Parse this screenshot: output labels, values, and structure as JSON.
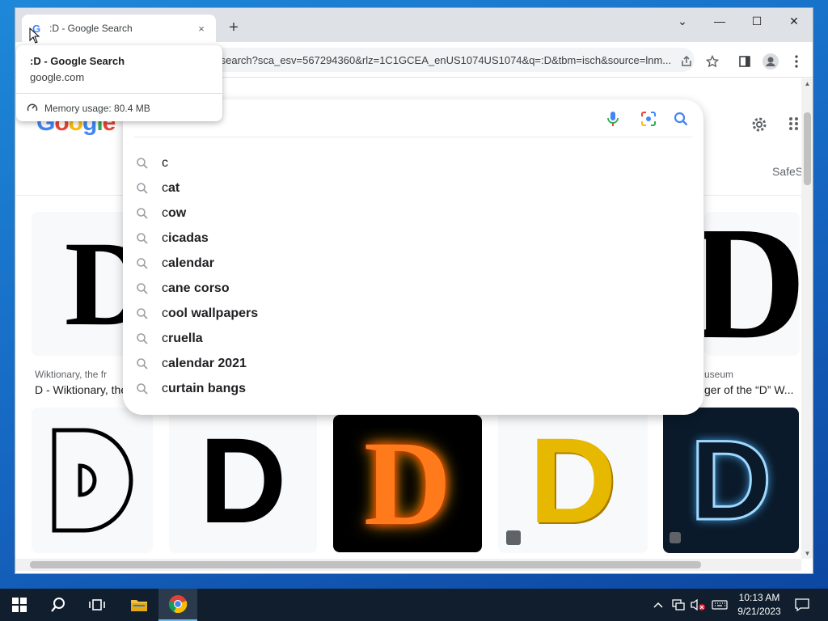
{
  "browser": {
    "tab": {
      "title": ":D - Google Search",
      "favicon": "G",
      "close": "×"
    },
    "new_tab": "+",
    "address": "/search?sca_esv=567294360&rlz=1C1GCEA_enUS1074US1074&q=:D&tbm=isch&source=lnm...",
    "window_controls": {
      "dropdown": "⌄",
      "minimize": "—",
      "maximize": "☐",
      "close": "✕"
    }
  },
  "hover_card": {
    "title": ":D - Google Search",
    "domain": "google.com",
    "memory": "Memory usage: 80.4 MB"
  },
  "page": {
    "logo": [
      "G",
      "o",
      "o",
      "g",
      "l",
      "e"
    ],
    "safesearch": "SafeS",
    "search_query": "c",
    "suggestions": [
      {
        "prefix": "c",
        "rest": ""
      },
      {
        "prefix": "c",
        "rest": "at"
      },
      {
        "prefix": "c",
        "rest": "ow"
      },
      {
        "prefix": "c",
        "rest": "icadas"
      },
      {
        "prefix": "c",
        "rest": "alendar"
      },
      {
        "prefix": "c",
        "rest": "ane corso"
      },
      {
        "prefix": "c",
        "rest": "ool wallpapers"
      },
      {
        "prefix": "c",
        "rest": "ruella"
      },
      {
        "prefix": "c",
        "rest": "alendar 2021"
      },
      {
        "prefix": "c",
        "rest": "urtain bangs"
      }
    ],
    "results_row1": [
      {
        "letter": "D",
        "source": "Wiktionary, the fr",
        "title": "D - Wiktionary, the"
      },
      {
        "letter": "D",
        "source": "useum",
        "title": "ger of the “D” W..."
      }
    ],
    "results_row2": [
      {
        "letter": "D"
      },
      {
        "letter": "D"
      },
      {
        "letter": "D"
      },
      {
        "letter": "D"
      },
      {
        "letter": "D"
      }
    ]
  },
  "taskbar": {
    "time": "10:13 AM",
    "date": "9/21/2023"
  },
  "colors": {
    "accent_blue": "#4285f4",
    "taskbar": "#101e2e",
    "desktop": "#1565c0"
  }
}
